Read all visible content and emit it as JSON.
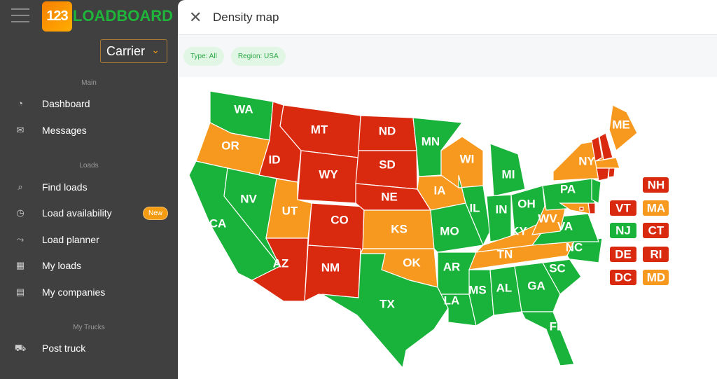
{
  "sidebar": {
    "logo_number": "123",
    "logo_text": "LOADBOARD",
    "role": "Carrier",
    "sections": [
      "Main",
      "Loads",
      "My Trucks"
    ],
    "items": [
      {
        "label": "Dashboard",
        "icon": "gauge-icon"
      },
      {
        "label": "Messages",
        "icon": "envelope-icon"
      },
      {
        "label": "Find loads",
        "icon": "search-truck-icon"
      },
      {
        "label": "Load availability",
        "icon": "clock-icon",
        "badge": "New"
      },
      {
        "label": "Load planner",
        "icon": "route-icon"
      },
      {
        "label": "My loads",
        "icon": "boxes-icon"
      },
      {
        "label": "My companies",
        "icon": "clipboard-icon"
      },
      {
        "label": "Post truck",
        "icon": "truck-icon"
      }
    ]
  },
  "header": {
    "title": "Density map"
  },
  "filters": [
    "Type: All",
    "Region: USA"
  ],
  "colors": {
    "high": "#d9290f",
    "medium": "#f7991e",
    "low": "#19b23a"
  },
  "states": {
    "WA": "low",
    "OR": "medium",
    "CA": "low",
    "NV": "low",
    "ID": "high",
    "MT": "high",
    "WY": "high",
    "UT": "medium",
    "CO": "high",
    "AZ": "high",
    "NM": "high",
    "ND": "high",
    "SD": "high",
    "NE": "high",
    "KS": "medium",
    "OK": "medium",
    "TX": "low",
    "MN": "low",
    "IA": "medium",
    "MO": "low",
    "AR": "low",
    "LA": "low",
    "WI": "medium",
    "IL": "low",
    "MI": "low",
    "IN": "low",
    "OH": "low",
    "KY": "medium",
    "TN": "medium",
    "MS": "low",
    "AL": "low",
    "GA": "low",
    "FL": "low",
    "SC": "low",
    "NC": "low",
    "VA": "low",
    "WV": "medium",
    "PA": "low",
    "NY": "medium",
    "ME": "medium",
    "VT": "high",
    "NH": "high",
    "MA": "medium",
    "CT": "high",
    "RI": "high",
    "NJ": "low",
    "DE": "high",
    "MD": "medium",
    "DC": "high"
  },
  "small_state_labels": [
    "NH",
    "VT",
    "MA",
    "NJ",
    "CT",
    "DE",
    "RI",
    "DC",
    "MD"
  ]
}
